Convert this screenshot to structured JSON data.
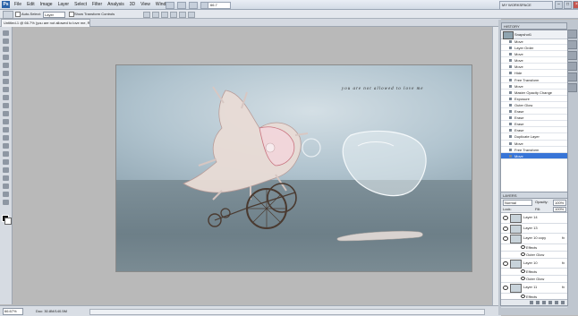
{
  "menubar": {
    "logo": "Ps",
    "items": [
      "File",
      "Edit",
      "Image",
      "Layer",
      "Select",
      "Filter",
      "Analysis",
      "3D",
      "View",
      "Window",
      "Help"
    ],
    "zoom": "66.7",
    "workspace": "MY WORKSPACE"
  },
  "options": {
    "auto_select_label": "Auto-Select:",
    "auto_select_value": "Layer",
    "transform_label": "Show Transform Controls"
  },
  "document": {
    "tab_title": "Untitled-1 @ 66.7% (you are not allowed to love me, RGB/8)",
    "caption": "you are not allowed to love me"
  },
  "status": {
    "zoom": "66.67%",
    "doc_size": "Doc: 30.8M/140.5M"
  },
  "history": {
    "header": "HISTORY",
    "snapshot": "Snapshot1",
    "items": [
      "Move",
      "Layer Order",
      "Move",
      "Move",
      "Move",
      "Hide",
      "Free Transform",
      "Move",
      "Master Opacity Change",
      "Exposure",
      "Outer Glow",
      "Erase",
      "Erase",
      "Erase",
      "Erase",
      "Duplicate Layer",
      "Move",
      "Free Transform",
      "Move"
    ],
    "selected_index": 18
  },
  "layers": {
    "header": "LAYERS",
    "blend_mode": "Normal",
    "opacity_label": "Opacity:",
    "opacity_value": "100%",
    "lock_label": "Lock:",
    "fill_label": "Fill:",
    "fill_value": "100%",
    "rows": [
      {
        "name": "Layer 14",
        "sub": false,
        "fx": ""
      },
      {
        "name": "Layer 13",
        "sub": false,
        "fx": ""
      },
      {
        "name": "Layer 10 copy",
        "sub": false,
        "fx": "fx"
      },
      {
        "name": "Effects",
        "sub": true,
        "fx": ""
      },
      {
        "name": "Outer Glow",
        "sub": true,
        "fx": ""
      },
      {
        "name": "Layer 10",
        "sub": false,
        "fx": "fx"
      },
      {
        "name": "Effects",
        "sub": true,
        "fx": ""
      },
      {
        "name": "Outer Glow",
        "sub": true,
        "fx": ""
      },
      {
        "name": "Layer 11",
        "sub": false,
        "fx": "fx"
      },
      {
        "name": "Effects",
        "sub": true,
        "fx": ""
      },
      {
        "name": "Outer Glow",
        "sub": true,
        "fx": ""
      }
    ]
  },
  "colors": {
    "selection": "#3875d7",
    "wall": "#b1c4cf",
    "floor": "#6d7f88"
  }
}
